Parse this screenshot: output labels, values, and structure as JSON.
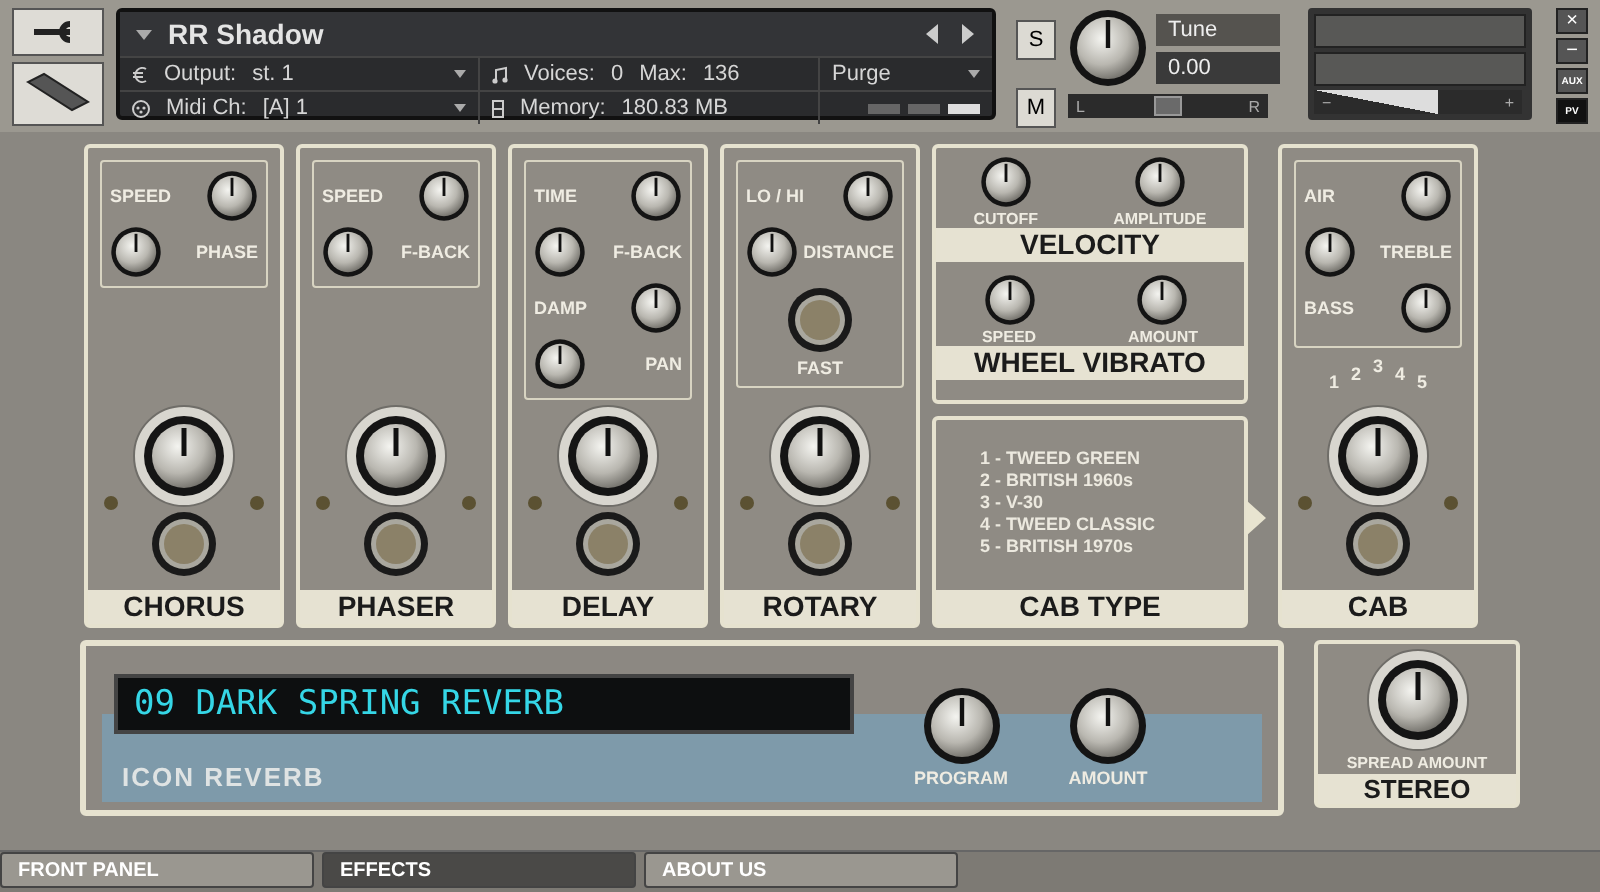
{
  "header": {
    "instrument_name": "RR Shadow",
    "output_label": "Output:",
    "output_value": "st. 1",
    "midi_label": "Midi Ch:",
    "midi_value": "[A] 1",
    "voices_label": "Voices:",
    "voices": "0",
    "max_label": "Max:",
    "max": "136",
    "memory_label": "Memory:",
    "memory": "180.83 MB",
    "purge": "Purge",
    "solo": "S",
    "mute": "M",
    "tune_label": "Tune",
    "tune_value": "0.00",
    "pan": {
      "left": "L",
      "right": "R",
      "level": 0.5
    },
    "volume": {
      "minus": "−",
      "plus": "+",
      "level": 0.6
    },
    "close": "×",
    "minimize": "−",
    "aux": "AUX",
    "pv": "PV"
  },
  "modules": [
    {
      "title": "CHORUS",
      "knobs": [
        {
          "label": "SPEED"
        },
        {
          "label": "PHASE"
        }
      ]
    },
    {
      "title": "PHASER",
      "knobs": [
        {
          "label": "SPEED"
        },
        {
          "label": "F-BACK"
        }
      ]
    },
    {
      "title": "DELAY",
      "knobs": [
        {
          "label": "TIME"
        },
        {
          "label": "F-BACK"
        },
        {
          "label": "DAMP"
        },
        {
          "label": "PAN"
        }
      ]
    },
    {
      "title": "ROTARY",
      "knobs": [
        {
          "label": "LO / HI"
        },
        {
          "label": "DISTANCE"
        }
      ],
      "button": "FAST"
    }
  ],
  "velocity": {
    "title": "VELOCITY",
    "knobs": [
      {
        "label": "CUTOFF"
      },
      {
        "label": "AMPLITUDE"
      }
    ]
  },
  "wheel_vibrato": {
    "title": "WHEEL VIBRATO",
    "knobs": [
      {
        "label": "SPEED"
      },
      {
        "label": "AMOUNT"
      }
    ]
  },
  "cab_type": {
    "title": "CAB TYPE",
    "items": [
      "1 - TWEED GREEN",
      "2 - BRITISH 1960s",
      "3 - V-30",
      "4 - TWEED CLASSIC",
      "5 - BRITISH 1970s"
    ]
  },
  "cab": {
    "title": "CAB",
    "knobs": [
      {
        "label": "AIR"
      },
      {
        "label": "TREBLE"
      },
      {
        "label": "BASS"
      }
    ],
    "positions": [
      "1",
      "2",
      "3",
      "4",
      "5"
    ]
  },
  "reverb": {
    "display": "09 DARK SPRING REVERB",
    "name": "ICON REVERB",
    "knobs": [
      {
        "label": "PROGRAM"
      },
      {
        "label": "AMOUNT"
      }
    ]
  },
  "stereo": {
    "title": "STEREO",
    "knob_label": "SPREAD AMOUNT"
  },
  "tabs": [
    {
      "label": "FRONT PANEL",
      "selected": false
    },
    {
      "label": "EFFECTS",
      "selected": true
    },
    {
      "label": "ABOUT US",
      "selected": false
    }
  ]
}
